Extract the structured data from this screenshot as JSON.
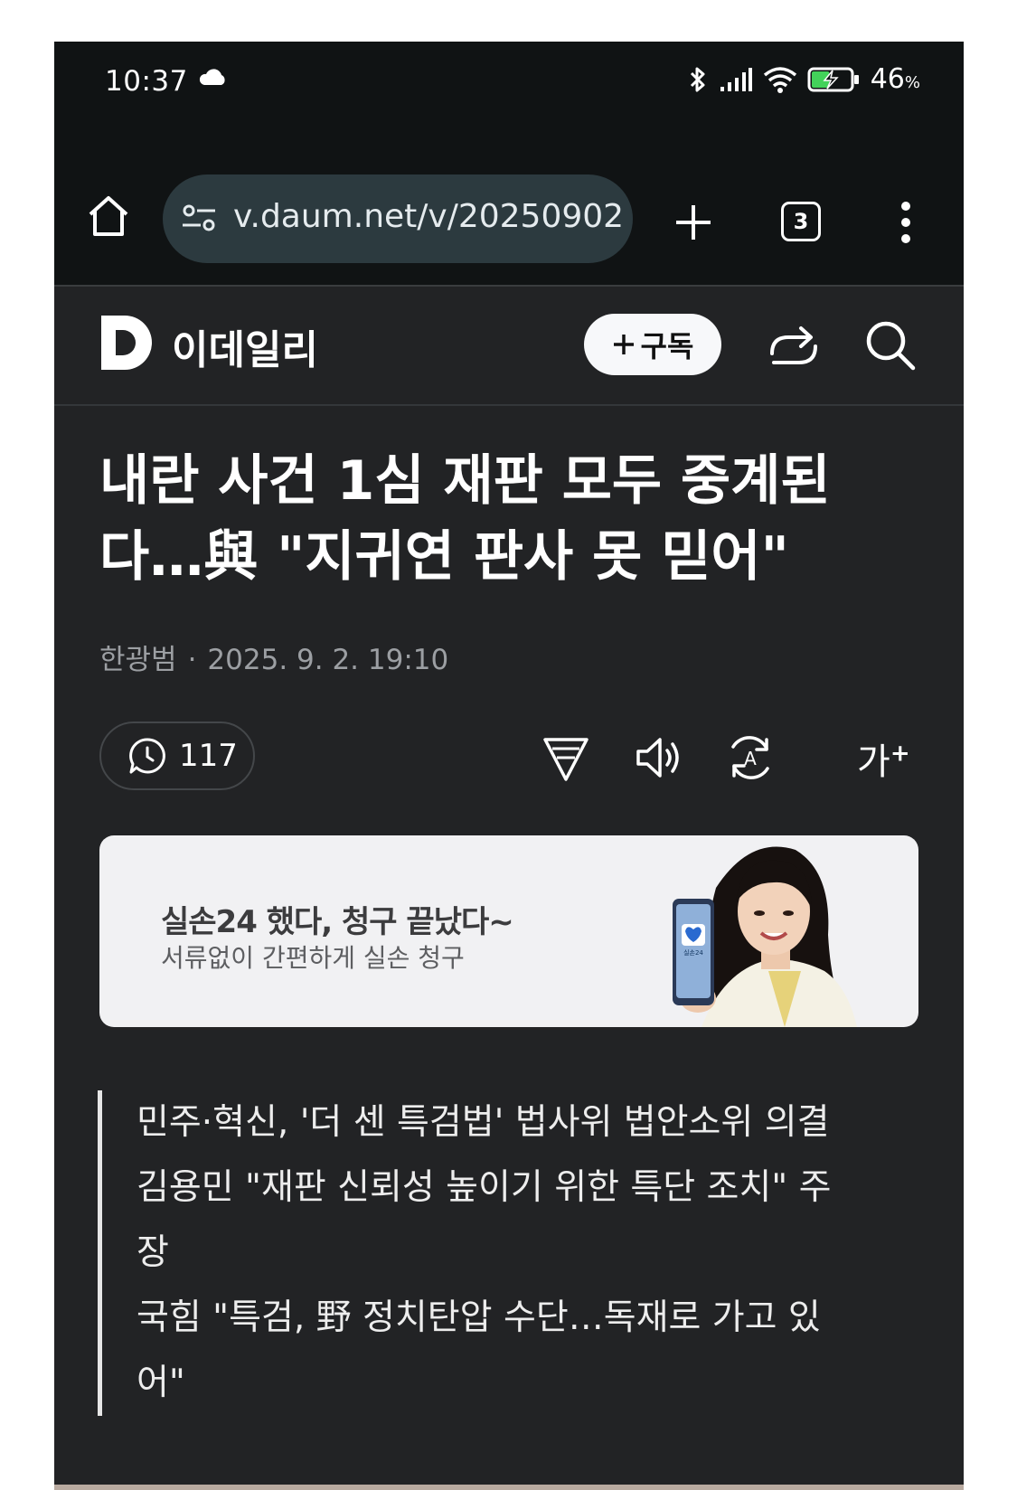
{
  "status_bar": {
    "time": "10:37",
    "battery_value": "46",
    "battery_unit": "%",
    "battery_level": 0.46
  },
  "browser": {
    "url": "v.daum.net/v/20250902",
    "tab_count": "3"
  },
  "site": {
    "name": "이데일리",
    "subscribe_label": "구독"
  },
  "article": {
    "title_line1": "내란 사건 1심 재판 모두 중계된",
    "title_line2": "다…與 \"지귀연 판사 못 믿어\"",
    "author": "한광범",
    "dot": "·",
    "datetime": "2025. 9. 2. 19:10",
    "comment_count": "117",
    "font_tool_label": "가",
    "font_tool_sup": "+"
  },
  "ad": {
    "headline": "실손24 했다, 청구 끝났다~",
    "subline": "서류없이 간편하게 실손 청구",
    "phone_label": "실손24"
  },
  "summary": {
    "line1": "민주·혁신, '더 센 특검법' 법사위 법안소위 의결",
    "line2": "김용민 \"재판 신뢰성 높이기 위한 특단 조치\" 주",
    "line3": "장",
    "line4": "국힘 \"특검, 野 정치탄압 수단…독재로 가고 있",
    "line5": "어\""
  }
}
